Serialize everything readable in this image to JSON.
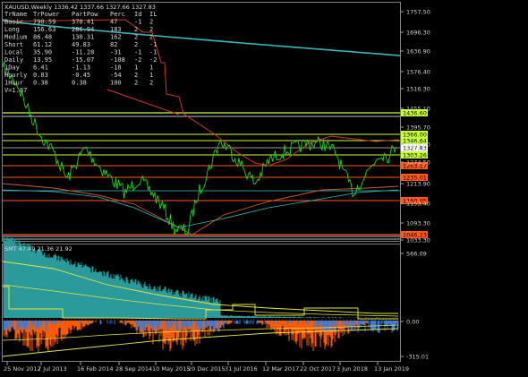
{
  "main": {
    "header": "XAUUSD,Weekly  1336.42 1337.66 1327.66 1327.83",
    "table": {
      "headers": [
        "TrName",
        "TrPower",
        "PartPow",
        "Perc",
        "Id",
        "IL"
      ],
      "rows": [
        [
          "Basic",
          "790.59",
          "370.41",
          "47",
          "-1",
          "2"
        ],
        [
          "Long",
          "156.63",
          "286.94",
          "183",
          "2",
          "2"
        ],
        [
          "Medium",
          "86.48",
          "130.31",
          "162",
          "2",
          "2"
        ],
        [
          "Short",
          "61.12",
          "49.83",
          "82",
          "2",
          "-1"
        ],
        [
          "Local",
          "35.90",
          "-11.28",
          "-31",
          "-1",
          "-1"
        ],
        [
          "Daily",
          "13.95",
          "-15.07",
          "-108",
          "-2",
          "-2"
        ],
        [
          "1Day",
          "6.41",
          "-1.13",
          "-18",
          "1",
          "1"
        ],
        [
          "Hourly",
          "0.83",
          "-0.45",
          "-54",
          "2",
          "1"
        ],
        [
          "1Hour",
          "0.38",
          "0.38",
          "100",
          "2",
          "2"
        ]
      ],
      "footer": "V=1.87"
    },
    "price_scale": [
      "1757.50",
      "1696.30",
      "1636.90",
      "1576.40",
      "1516.30",
      "1455.10",
      "1395.70",
      "1334.60",
      "1274.50",
      "1213.90",
      "1153.40",
      "1093.30",
      "1033.30"
    ],
    "level_tags": [
      {
        "text": "1436.60",
        "color": "#c8ff3c"
      },
      {
        "text": "1366.00",
        "color": "#c8ff3c"
      },
      {
        "text": "1346.64",
        "color": "#c8ff3c"
      },
      {
        "text": "1327.83",
        "color": "#ffffff"
      },
      {
        "text": "1303.26",
        "color": "#c8ff3c"
      },
      {
        "text": "1263.17",
        "color": "#ff5a1e"
      },
      {
        "text": "1235.01",
        "color": "#ff5a1e"
      },
      {
        "text": "1160.05",
        "color": "#ff5a1e"
      },
      {
        "text": "1046.23",
        "color": "#ff5a1e"
      }
    ]
  },
  "sub": {
    "header": "SMT 47.49 21.36 21.92",
    "scale": [
      "566.09",
      "0.00",
      "-315.01"
    ]
  },
  "time_axis": [
    "25 Nov 2012",
    "7 Jul 2013",
    "16 Feb 2014",
    "28 Sep 2014",
    "10 May 2015",
    "20 Dec 2015",
    "31 Jul 2016",
    "12 Mar 2017",
    "22 Oct 2017",
    "3 Jun 2018",
    "13 Jan 2019"
  ],
  "colors": {
    "price": "#1fd21f",
    "cyan_ma": "#38b8b8",
    "red_ma": "#c83c1e",
    "support": "#ff3c14",
    "resistance": "#c8ff3c",
    "hist_cyan": "#2a9a9a",
    "hist_orange": "#ff5a00",
    "hist_blue": "#3a7ad8"
  }
}
